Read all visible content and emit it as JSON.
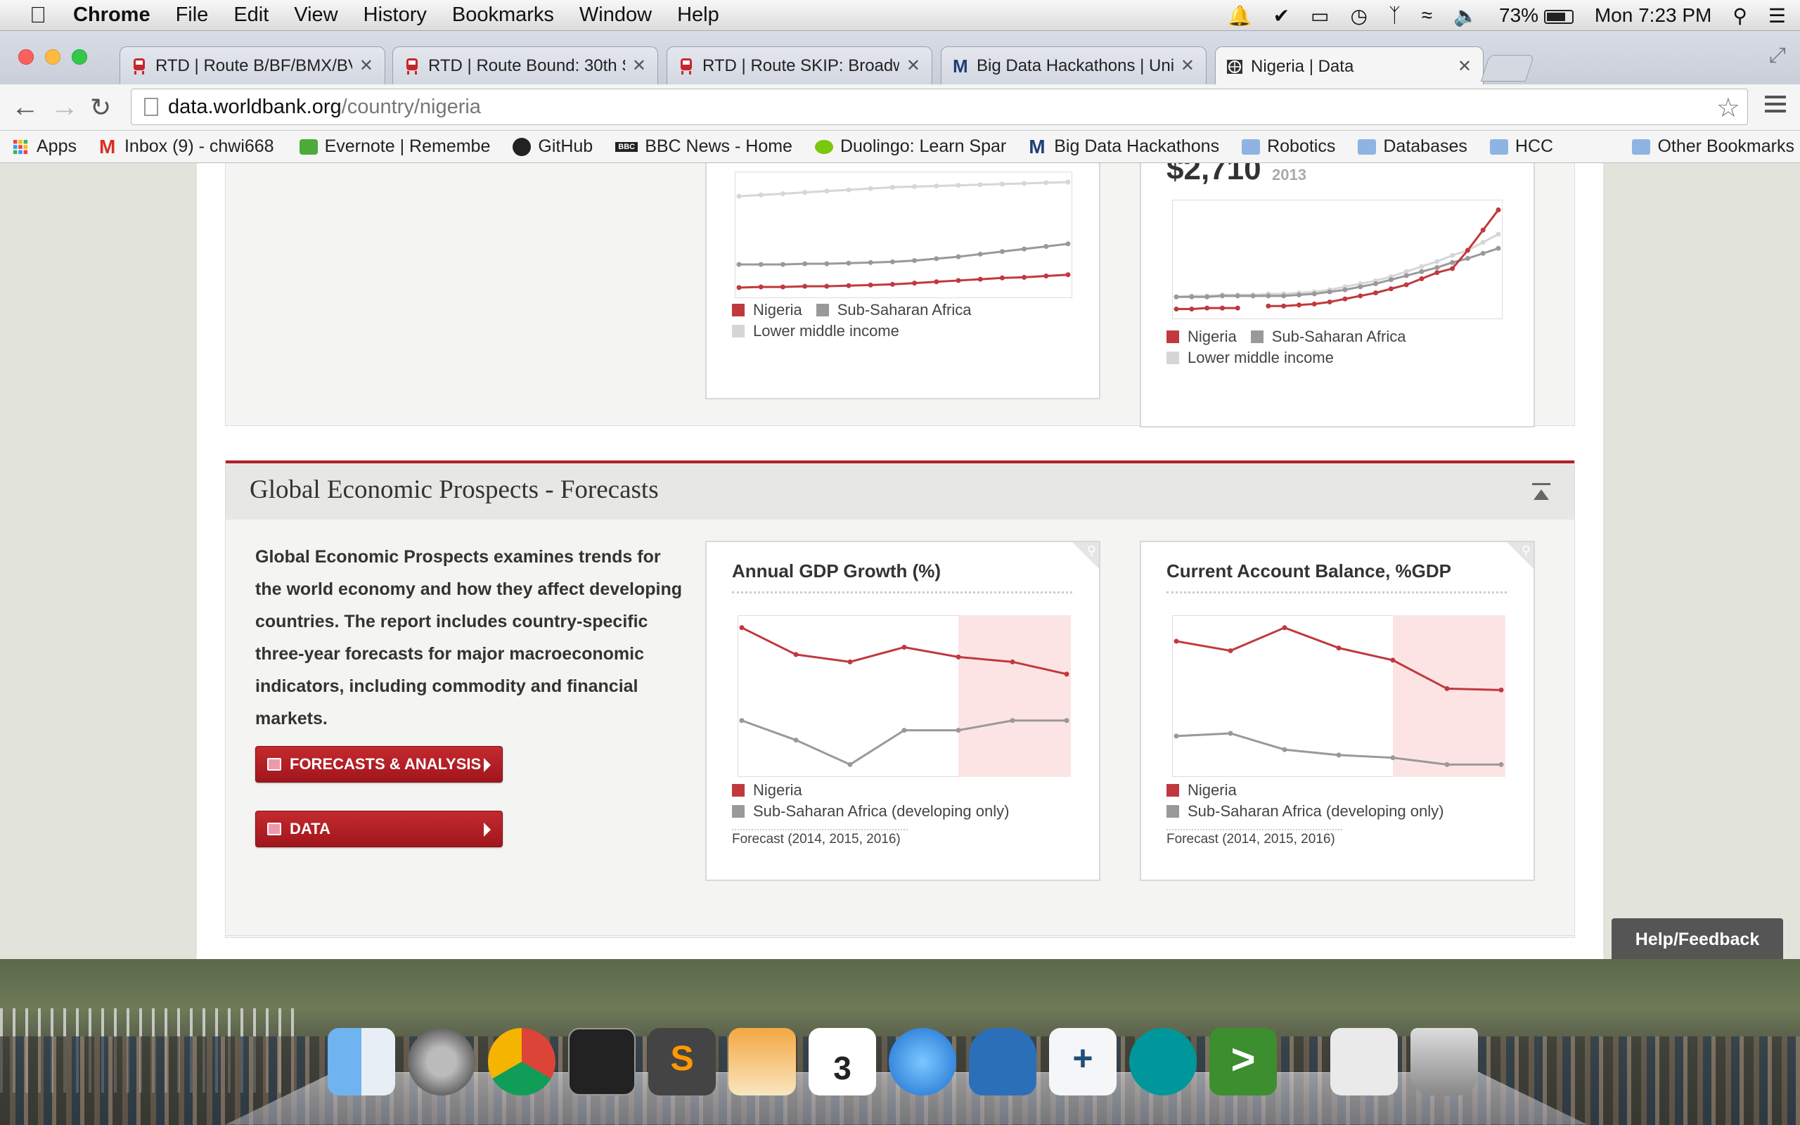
{
  "menubar": {
    "app": "Chrome",
    "items": [
      "File",
      "Edit",
      "View",
      "History",
      "Bookmarks",
      "Window",
      "Help"
    ],
    "battery": "73%",
    "clock": "Mon 7:23 PM"
  },
  "tabs": [
    {
      "label": "RTD | Route B/BF/BMX/BV/",
      "active": false
    },
    {
      "label": "RTD | Route Bound: 30th S",
      "active": false
    },
    {
      "label": "RTD | Route SKIP: Broadwa",
      "active": false
    },
    {
      "label": "Big Data Hackathons | Univ",
      "active": false
    },
    {
      "label": "Nigeria | Data",
      "active": true
    }
  ],
  "address": {
    "host": "data.worldbank.org",
    "path": "/country/nigeria"
  },
  "bookmarks": [
    {
      "label": "Apps",
      "icon": "apps-grid-icon"
    },
    {
      "label": "Inbox (9) - chwi668",
      "icon": "gmail-icon"
    },
    {
      "label": "Evernote | Remembe",
      "icon": "evernote-icon"
    },
    {
      "label": "GitHub",
      "icon": "github-icon"
    },
    {
      "label": "BBC News - Home",
      "icon": "bbc-icon"
    },
    {
      "label": "Duolingo: Learn Spar",
      "icon": "duolingo-icon"
    },
    {
      "label": "Big Data Hackathons",
      "icon": "m-logo-icon"
    },
    {
      "label": "Robotics",
      "icon": "folder-icon"
    },
    {
      "label": "Databases",
      "icon": "folder-icon"
    },
    {
      "label": "HCC",
      "icon": "folder-icon"
    }
  ],
  "other_bookmarks": "Other Bookmarks",
  "top_cards": {
    "card2_value": "$2,710",
    "card2_year": "2013",
    "legend": [
      "Nigeria",
      "Sub-Saharan Africa",
      "Lower middle income"
    ]
  },
  "gep": {
    "title": "Global Economic Prospects - Forecasts",
    "description": "Global Economic Prospects examines trends for the world economy and how they affect developing countries. The report includes country-specific three-year forecasts for major macroeconomic indicators, including commodity and financial markets.",
    "buttons": [
      "FORECASTS & ANALYSIS",
      "DATA"
    ],
    "charts": [
      {
        "title": "Annual GDP Growth (%)",
        "legend": [
          "Nigeria",
          "Sub-Saharan Africa (developing only)"
        ],
        "note": "Forecast (2014, 2015, 2016)"
      },
      {
        "title": "Current Account Balance, %GDP",
        "legend": [
          "Nigeria",
          "Sub-Saharan Africa (developing only)"
        ],
        "note": "Forecast (2014, 2015, 2016)"
      }
    ]
  },
  "help": "Help/Feedback",
  "colors": {
    "nigeria": "#c0393e",
    "ssa": "#999999",
    "lmi": "#d6d6d6",
    "forecast_band": "#fde4e4",
    "accent": "#b51f25"
  },
  "chart_data": [
    {
      "type": "line",
      "title": "",
      "series": [
        {
          "name": "Nigeria",
          "values": [
            0,
            0.5,
            0.5,
            1,
            1,
            1.5,
            2,
            2.5,
            3.5,
            4.5,
            5.5,
            6.5,
            7.5,
            8,
            9,
            10
          ]
        },
        {
          "name": "Sub-Saharan Africa",
          "values": [
            18,
            18,
            18,
            18.5,
            18.5,
            19,
            19.5,
            20,
            21,
            22.5,
            24,
            26,
            28,
            30,
            32,
            34
          ]
        },
        {
          "name": "Lower middle income",
          "values": [
            71,
            72,
            73,
            74,
            75,
            76,
            77,
            78,
            78.5,
            79,
            79.5,
            80,
            80.5,
            81,
            81.5,
            82
          ]
        }
      ]
    },
    {
      "type": "line",
      "title": "",
      "series": [
        {
          "name": "Nigeria",
          "values": [
            2,
            2,
            3,
            3,
            3,
            null,
            5,
            5,
            6,
            7,
            9,
            12,
            15,
            18,
            22,
            26,
            32,
            38,
            42,
            60,
            80,
            100
          ]
        },
        {
          "name": "Sub-Saharan Africa",
          "values": [
            14,
            14,
            14,
            15,
            15,
            15,
            15,
            15,
            16,
            17,
            19,
            21,
            24,
            27,
            31,
            35,
            39,
            43,
            48,
            52,
            57,
            62
          ]
        },
        {
          "name": "Lower middle income",
          "values": [
            14,
            15,
            15,
            16,
            16,
            16,
            17,
            17,
            18,
            19,
            21,
            24,
            27,
            30,
            34,
            39,
            44,
            49,
            55,
            60,
            68,
            76
          ]
        }
      ]
    },
    {
      "type": "line",
      "title": "Annual GDP Growth (%)",
      "forecast_from_index": 4,
      "series": [
        {
          "name": "Nigeria",
          "values": [
            7.8,
            6.7,
            6.4,
            7.0,
            6.6,
            6.4,
            5.9
          ]
        },
        {
          "name": "Sub-Saharan Africa (developing only)",
          "values": [
            4.0,
            3.2,
            2.2,
            3.6,
            3.6,
            4.0,
            4.0
          ]
        }
      ]
    },
    {
      "type": "line",
      "title": "Current Account Balance, %GDP",
      "forecast_from_index": 4,
      "series": [
        {
          "name": "Nigeria",
          "values": [
            5.8,
            5.1,
            6.8,
            5.3,
            4.4,
            2.3,
            2.2
          ]
        },
        {
          "name": "Sub-Saharan Africa (developing only)",
          "values": [
            -1.2,
            -1.0,
            -2.2,
            -2.6,
            -2.8,
            -3.3,
            -3.3
          ]
        }
      ]
    }
  ]
}
